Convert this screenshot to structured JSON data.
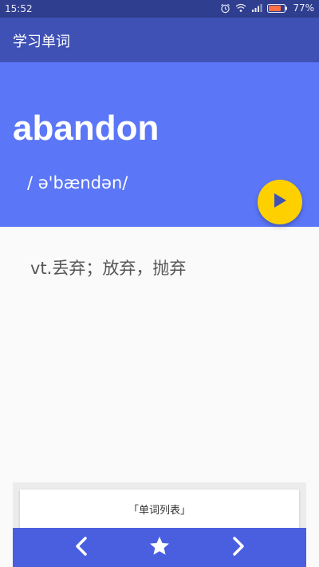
{
  "status_bar": {
    "time": "15:52",
    "battery": "77%",
    "icons": [
      "alarm-icon",
      "wifi-icon",
      "signal-icon",
      "battery-icon"
    ]
  },
  "app_bar": {
    "title": "学习单词"
  },
  "word_card": {
    "word": "abandon",
    "phonetic": "/ ə'bændən/",
    "play_icon": "play-icon"
  },
  "meaning": "vt.丢弃；放弃，抛弃",
  "word_list_button": "「单词列表」",
  "bottom_nav": {
    "prev_icon": "chevron-left-icon",
    "favorite_icon": "star-icon",
    "next_icon": "chevron-right-icon"
  },
  "colors": {
    "status_bar": "#2f3e8f",
    "app_bar": "#3f51b5",
    "hero": "#5b76f7",
    "fab": "#ffd000",
    "bottom_bar": "#4a5fe0"
  }
}
